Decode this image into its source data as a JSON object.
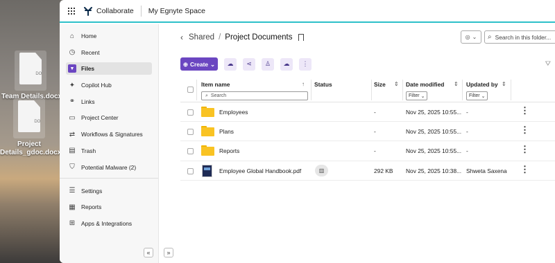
{
  "desktop": {
    "files": [
      {
        "icon_label": "DOCX",
        "name_lines": [
          "Team Details.docx"
        ]
      },
      {
        "icon_label": "DOCX",
        "name_lines": [
          "Project",
          "Details_gdoc.docx"
        ]
      }
    ]
  },
  "topbar": {
    "app_name": "Collaborate",
    "space_name": "My Egnyte Space",
    "accent_color": "#2cc0c9"
  },
  "sidebar": {
    "items": [
      {
        "label": "Home",
        "icon": "home-icon"
      },
      {
        "label": "Recent",
        "icon": "clock-icon"
      },
      {
        "label": "Files",
        "icon": "files-icon",
        "active": true
      },
      {
        "label": "Copilot Hub",
        "icon": "sparkle-icon"
      },
      {
        "label": "Links",
        "icon": "link-icon"
      },
      {
        "label": "Project Center",
        "icon": "briefcase-icon"
      },
      {
        "label": "Workflows & Signatures",
        "icon": "workflow-icon"
      },
      {
        "label": "Trash",
        "icon": "trash-icon"
      },
      {
        "label": "Potential Malware (2)",
        "icon": "shield-alert-icon"
      }
    ],
    "bottom_items": [
      {
        "label": "Settings",
        "icon": "settings-icon"
      },
      {
        "label": "Reports",
        "icon": "reports-icon"
      },
      {
        "label": "Apps & Integrations",
        "icon": "apps-icon"
      }
    ]
  },
  "breadcrumb": {
    "parent": "Shared",
    "separator": "/",
    "current": "Project Documents"
  },
  "search": {
    "placeholder": "Search in this folder..."
  },
  "toolbar": {
    "create_label": "Create",
    "brand_color": "#6b46c1"
  },
  "table": {
    "columns": {
      "name": "Item name",
      "status": "Status",
      "size": "Size",
      "date": "Date modified",
      "updated_by": "Updated by"
    },
    "name_search_placeholder": "Search",
    "filter_label": "Filter",
    "rows": [
      {
        "type": "folder",
        "name": "Employees",
        "status": "",
        "size": "-",
        "date": "Nov 25, 2025 10:55...",
        "updated_by": "-"
      },
      {
        "type": "folder",
        "name": "Plans",
        "status": "",
        "size": "-",
        "date": "Nov 25, 2025 10:55...",
        "updated_by": "-"
      },
      {
        "type": "folder",
        "name": "Reports",
        "status": "",
        "size": "-",
        "date": "Nov 25, 2025 10:55...",
        "updated_by": "-"
      },
      {
        "type": "pdf",
        "name": "Employee Global Handbook.pdf",
        "status": "report",
        "size": "292 KB",
        "date": "Nov 25, 2025 10:38...",
        "updated_by": "Shweta Saxena"
      }
    ]
  }
}
